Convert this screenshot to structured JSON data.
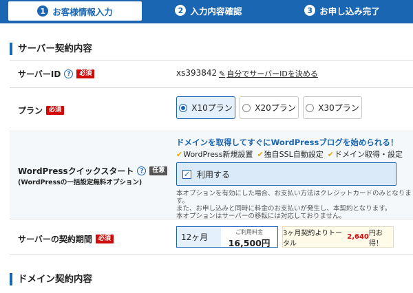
{
  "steps": [
    {
      "num": "1",
      "label": "お客様情報入力"
    },
    {
      "num": "2",
      "label": "入力内容確認"
    },
    {
      "num": "3",
      "label": "お申し込み完了"
    }
  ],
  "sections": {
    "server": "サーバー契約内容",
    "domain": "ドメイン契約内容"
  },
  "labels": {
    "server_id": "サーバーID",
    "plan": "プラン",
    "wp": "WordPressクイックスタート",
    "wp_sub": "(WordPressの一括設定無料オプション)",
    "period": "サーバーの契約期間"
  },
  "badges": {
    "required": "必須",
    "optional": "任意"
  },
  "server_id": {
    "value": "xs393842",
    "link": "自分でサーバーIDを決める"
  },
  "plans": [
    {
      "label": "X10プラン",
      "selected": true
    },
    {
      "label": "X20プラン",
      "selected": false
    },
    {
      "label": "X30プラン",
      "selected": false
    }
  ],
  "wp": {
    "headline": "ドメインを取得してすぐにWordPressブログを始められる！",
    "features": [
      "WordPress新規設置",
      "独自SSL自動設定",
      "ドメイン取得・設定"
    ],
    "use_label": "利用する",
    "use_checked": true,
    "notes": [
      "本オプションを有効にした場合、お支払い方法はクレジットカードのみとなります。",
      "また、お申し込みと同時に料金のお支払いが発生し、本契約となります。",
      "本オプションはサーバーの移転には対応しておりません。"
    ]
  },
  "period": {
    "selected": "12ヶ月",
    "fee_label": "ご利用料金",
    "fee": "16,500円",
    "promo_prefix": "3ヶ月契約よりトータル",
    "promo_amount": "2,640",
    "promo_suffix": "円お得！"
  },
  "colors": {
    "accent": "#1a66b3",
    "required": "#d10a0a",
    "check": "#e8a500"
  }
}
